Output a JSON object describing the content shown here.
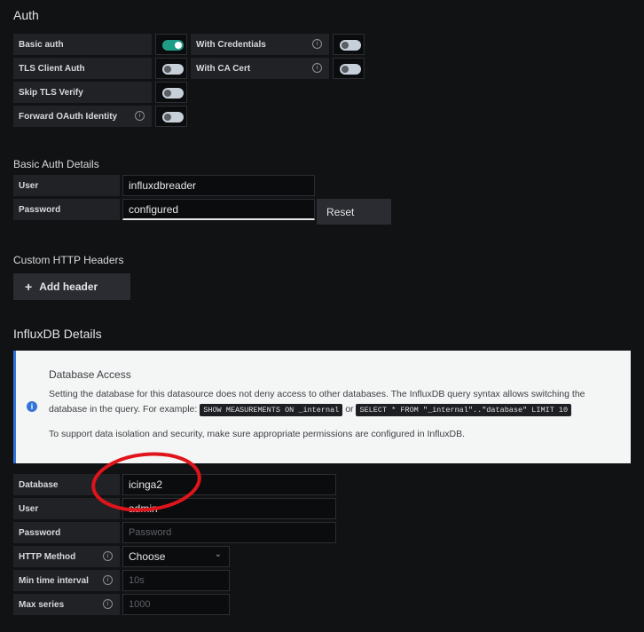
{
  "auth": {
    "title": "Auth",
    "basic_auth": "Basic auth",
    "with_credentials": "With Credentials",
    "tls_client_auth": "TLS Client Auth",
    "with_ca_cert": "With CA Cert",
    "skip_tls_verify": "Skip TLS Verify",
    "forward_oauth": "Forward OAuth Identity",
    "toggles": {
      "basic_auth": true,
      "with_credentials": false,
      "tls_client_auth": false,
      "with_ca_cert": false,
      "skip_tls_verify": false,
      "forward_oauth": false
    }
  },
  "basic_auth_details": {
    "title": "Basic Auth Details",
    "user_label": "User",
    "user_value": "influxdbreader",
    "password_label": "Password",
    "password_value": "configured",
    "reset_label": "Reset"
  },
  "custom_headers": {
    "title": "Custom HTTP Headers",
    "add_label": "Add header"
  },
  "influx": {
    "title": "InfluxDB Details",
    "alert_title": "Database Access",
    "alert_line1": "Setting the database for this datasource does not deny access to other databases. The InfluxDB query syntax allows switching the",
    "alert_line2": "database in the query. For example:",
    "code1": "SHOW MEASUREMENTS ON _internal",
    "or_text": "or",
    "code2": "SELECT * FROM \"_internal\"..\"database\" LIMIT 10",
    "alert_line3": "To support data isolation and security, make sure appropriate permissions are configured in InfluxDB.",
    "database_label": "Database",
    "database_value": "icinga2",
    "user_label": "User",
    "user_value": "admin",
    "password_label": "Password",
    "password_placeholder": "Password",
    "http_method_label": "HTTP Method",
    "http_method_value": "Choose",
    "min_interval_label": "Min time interval",
    "min_interval_placeholder": "10s",
    "max_series_label": "Max series",
    "max_series_placeholder": "1000"
  },
  "colors": {
    "toggle_on": "#1f9c86",
    "annotation": "#e0141b",
    "info_blue": "#3274d9"
  },
  "icons": [
    "info-icon",
    "plus-icon",
    "chevron-down-icon"
  ]
}
